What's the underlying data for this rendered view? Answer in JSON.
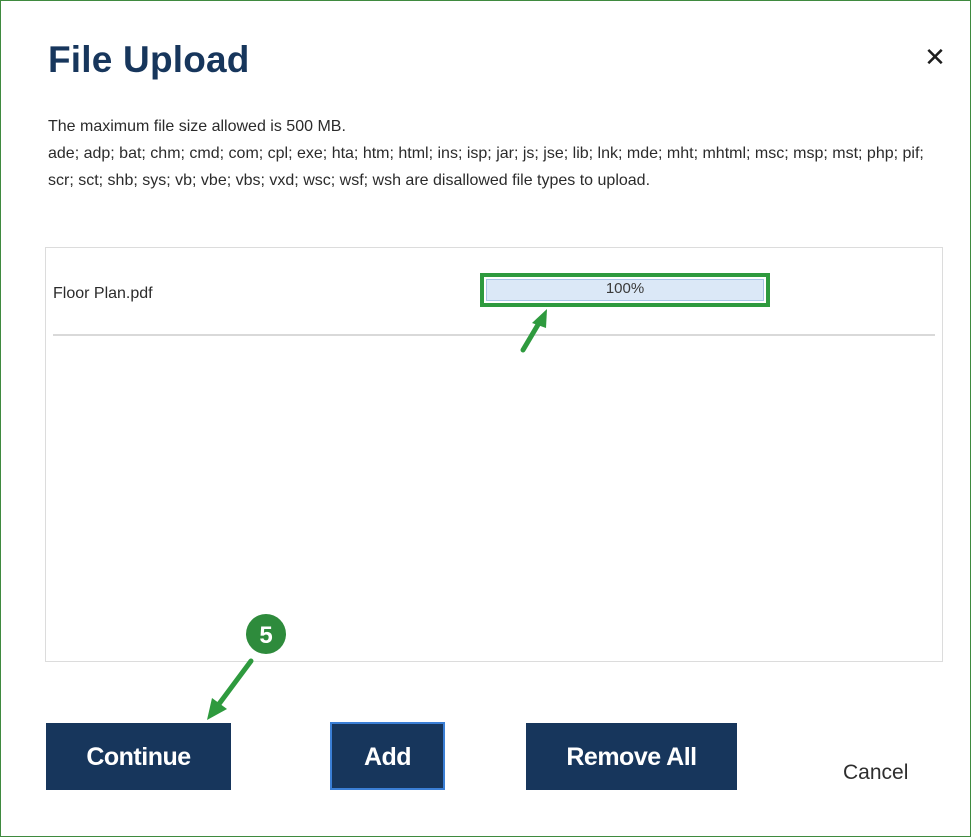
{
  "dialog": {
    "title": "File Upload",
    "close_icon": "close-icon",
    "close_glyph": "✕"
  },
  "info": {
    "max_size_text": "The maximum file size allowed is 500 MB.",
    "disallowed_text": "ade; adp; bat; chm; cmd; com; cpl; exe; hta; htm; html; ins; isp; jar; js; jse; lib; lnk; mde; mht; mhtml; msc; msp; mst; php; pif; scr; sct; shb; sys; vb; vbe; vbs; vxd; wsc; wsf; wsh are disallowed file types to upload."
  },
  "files": [
    {
      "name": "Floor Plan.pdf",
      "progress_label": "100%",
      "progress_fraction": 1.0
    }
  ],
  "annotations": {
    "step_number": "5",
    "highlight_color": "#2e9a3e",
    "arrow_color": "#2e9a3e"
  },
  "buttons": {
    "continue_label": "Continue",
    "add_label": "Add",
    "remove_all_label": "Remove All",
    "cancel_label": "Cancel"
  },
  "colors": {
    "primary": "#17365c",
    "progress_fill": "#dbe8f7",
    "add_focus_border": "#3b7fd6"
  }
}
